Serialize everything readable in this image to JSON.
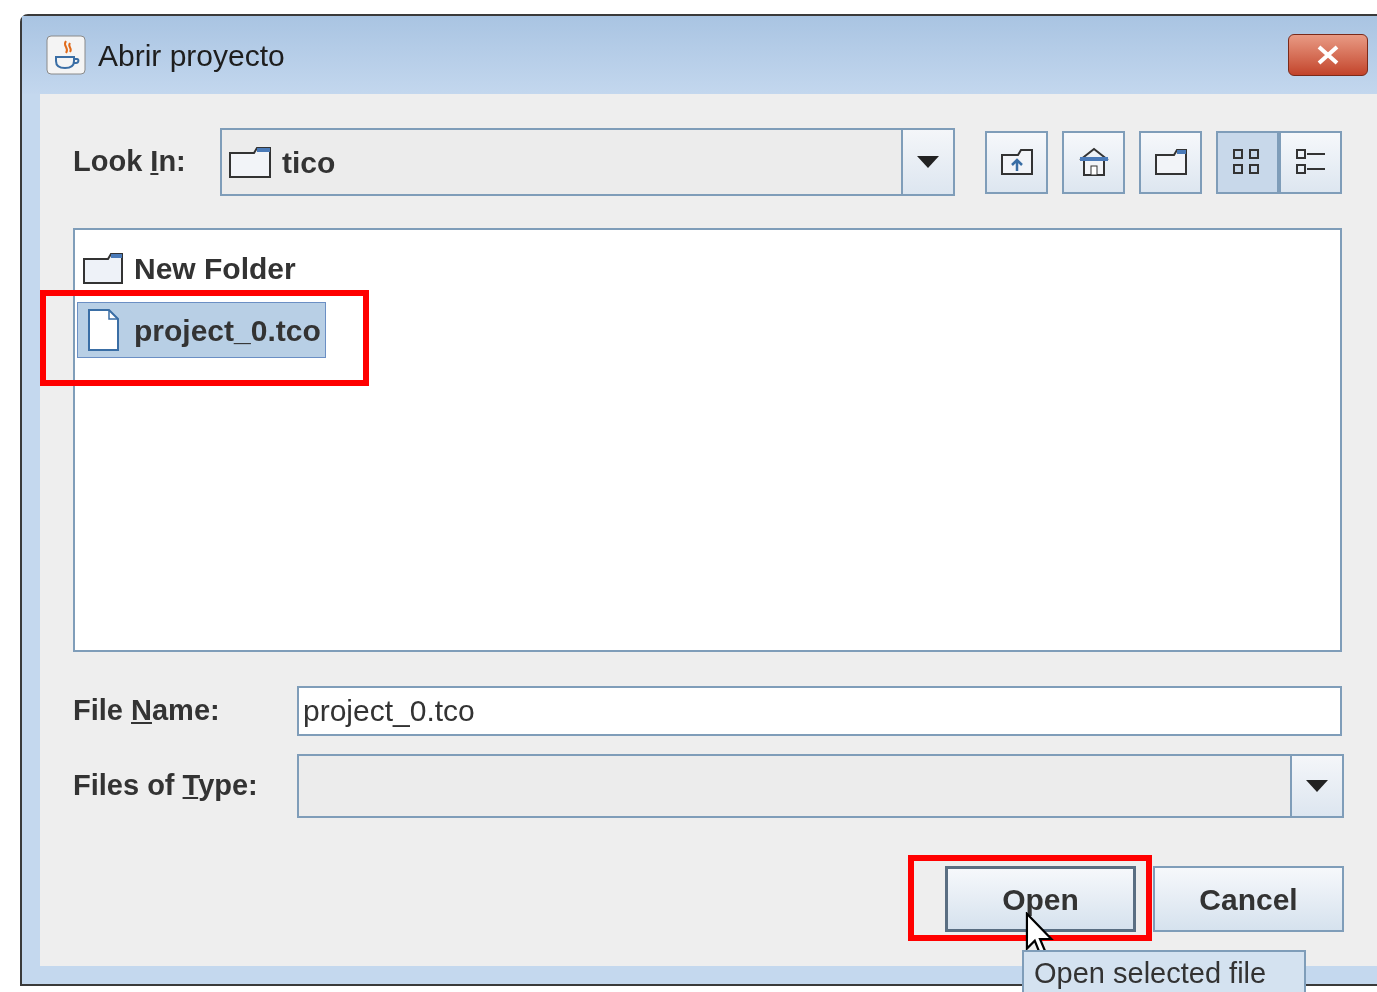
{
  "window": {
    "title": "Abrir proyecto"
  },
  "look_in": {
    "label_parts": [
      "Look ",
      "I",
      "n:"
    ],
    "value": "tico"
  },
  "nav_buttons": [
    {
      "kind": "up-folder"
    },
    {
      "kind": "home"
    },
    {
      "kind": "new-folder"
    }
  ],
  "view_buttons": [
    {
      "kind": "list",
      "selected": true
    },
    {
      "kind": "details",
      "selected": false
    }
  ],
  "files": [
    {
      "kind": "folder",
      "name": "New Folder",
      "selected": false,
      "highlighted": false
    },
    {
      "kind": "file",
      "name": "project_0.tco",
      "selected": true,
      "highlighted": true
    }
  ],
  "file_name": {
    "label_parts": [
      "File ",
      "N",
      "ame:"
    ],
    "value": "project_0.tco"
  },
  "file_type": {
    "label_parts": [
      "Files of ",
      "T",
      "ype:"
    ]
  },
  "buttons": [
    {
      "label": "Open",
      "focused": true,
      "highlighted": true,
      "hovered": true
    },
    {
      "label": "Cancel",
      "focused": false,
      "highlighted": false,
      "hovered": false
    }
  ],
  "tooltip": "Open selected file"
}
